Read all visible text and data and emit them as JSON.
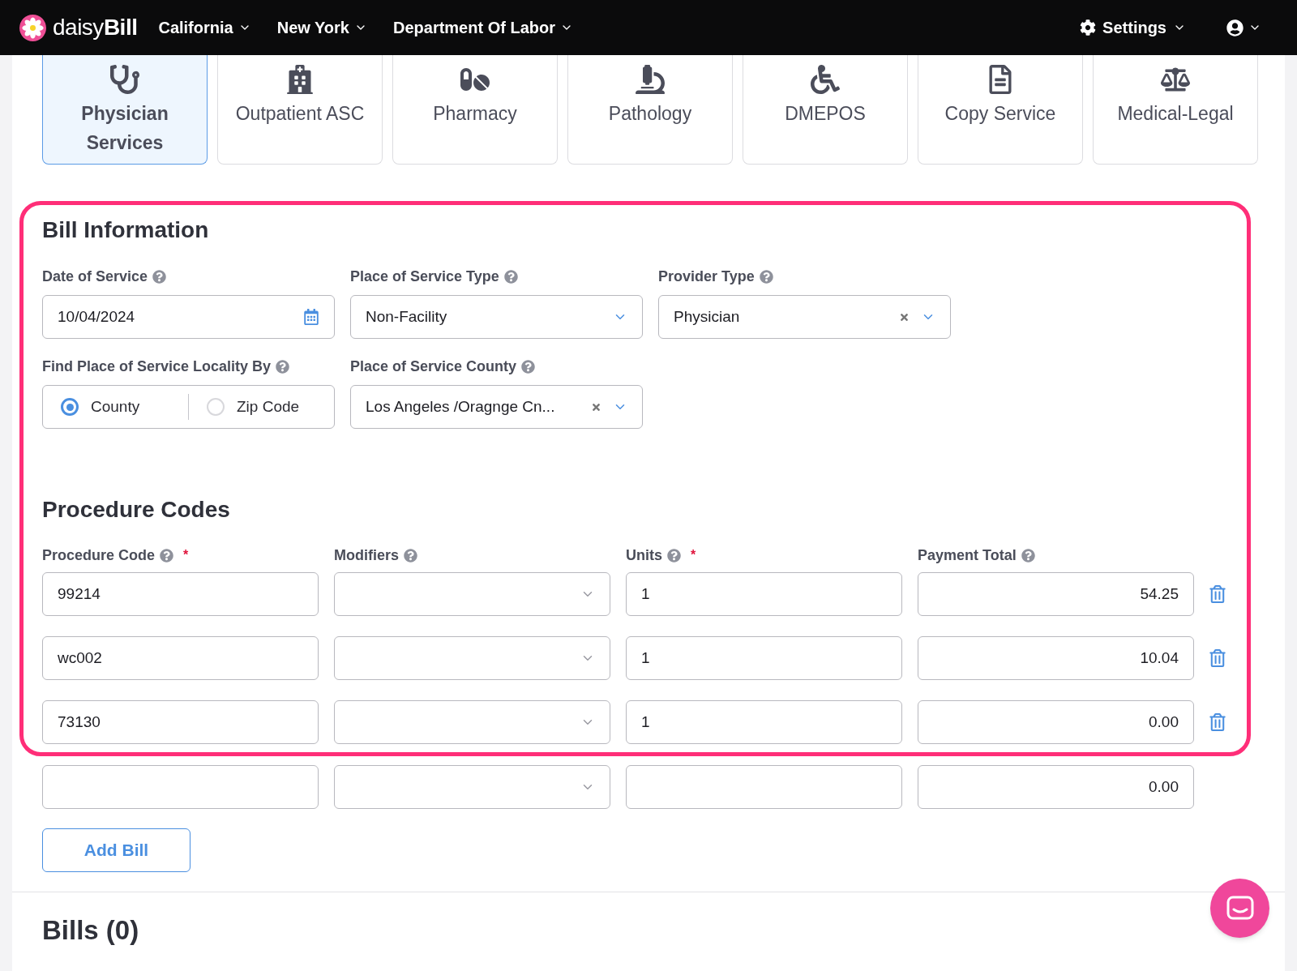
{
  "nav": {
    "brand": "daisy**Bill**",
    "menus": [
      "California",
      "New York",
      "Department Of Labor"
    ],
    "settings": "Settings"
  },
  "categories": [
    {
      "label": "Physician Services",
      "selected": true
    },
    {
      "label": "Outpatient ASC",
      "selected": false
    },
    {
      "label": "Pharmacy",
      "selected": false
    },
    {
      "label": "Pathology",
      "selected": false
    },
    {
      "label": "DMEPOS",
      "selected": false
    },
    {
      "label": "Copy Service",
      "selected": false
    },
    {
      "label": "Medical-Legal",
      "selected": false
    }
  ],
  "bill_information": {
    "title": "Bill Information",
    "date_of_service": {
      "label": "Date of Service",
      "value": "10/04/2024"
    },
    "place_of_service_type": {
      "label": "Place of Service Type",
      "value": "Non-Facility"
    },
    "provider_type": {
      "label": "Provider Type",
      "value": "Physician"
    },
    "locality": {
      "label": "Find Place of Service Locality By",
      "options": [
        {
          "label": "County",
          "selected": true
        },
        {
          "label": "Zip Code",
          "selected": false
        }
      ]
    },
    "county": {
      "label": "Place of Service County",
      "value": "Los Angeles /Oragnge Cn..."
    }
  },
  "procedure_codes": {
    "title": "Procedure Codes",
    "columns": [
      {
        "label": "Procedure Code",
        "required_mark": "*"
      },
      {
        "label": "Modifiers"
      },
      {
        "label": "Units",
        "required_mark": "*"
      },
      {
        "label": "Payment Total"
      }
    ],
    "rows": [
      {
        "code": "99214",
        "units": "1",
        "payment_total": "54.25",
        "deletable": true
      },
      {
        "code": "wc002",
        "units": "1",
        "payment_total": "10.04",
        "deletable": true
      },
      {
        "code": "73130",
        "units": "1",
        "payment_total": "0.00",
        "deletable": true
      },
      {
        "payment_total": "0.00",
        "deletable": false
      }
    ]
  },
  "add_button": "Add Bill",
  "bills_heading": "Bills (0)"
}
